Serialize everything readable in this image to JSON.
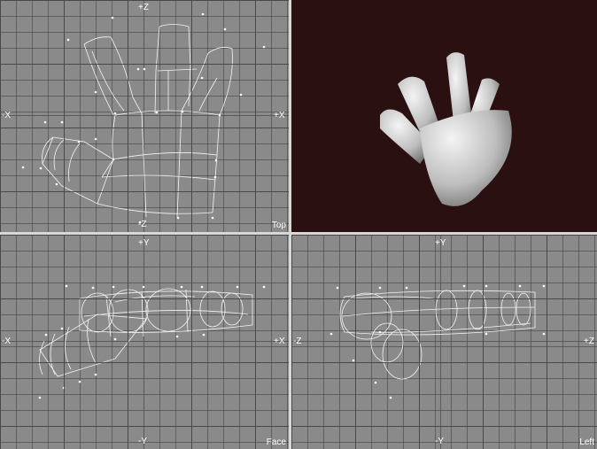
{
  "viewports": {
    "top": {
      "name": "Top",
      "axes": {
        "top": "+Z",
        "bottom": "-Z",
        "left": "-X",
        "right": "+X"
      }
    },
    "perspective": {
      "background": "#2a1010",
      "model_color": "#d8d8d8"
    },
    "face": {
      "name": "Face",
      "axes": {
        "top": "+Y",
        "bottom": "-Y",
        "left": "-X",
        "right": "+X"
      }
    },
    "left": {
      "name": "Left",
      "axes": {
        "top": "+Y",
        "bottom": "-Y",
        "left": "-Z",
        "right": "+Z"
      }
    }
  },
  "colors": {
    "grid": "#8a8a8a",
    "wireframe": "#f4f4f4",
    "separator": "#d8d8d8"
  }
}
